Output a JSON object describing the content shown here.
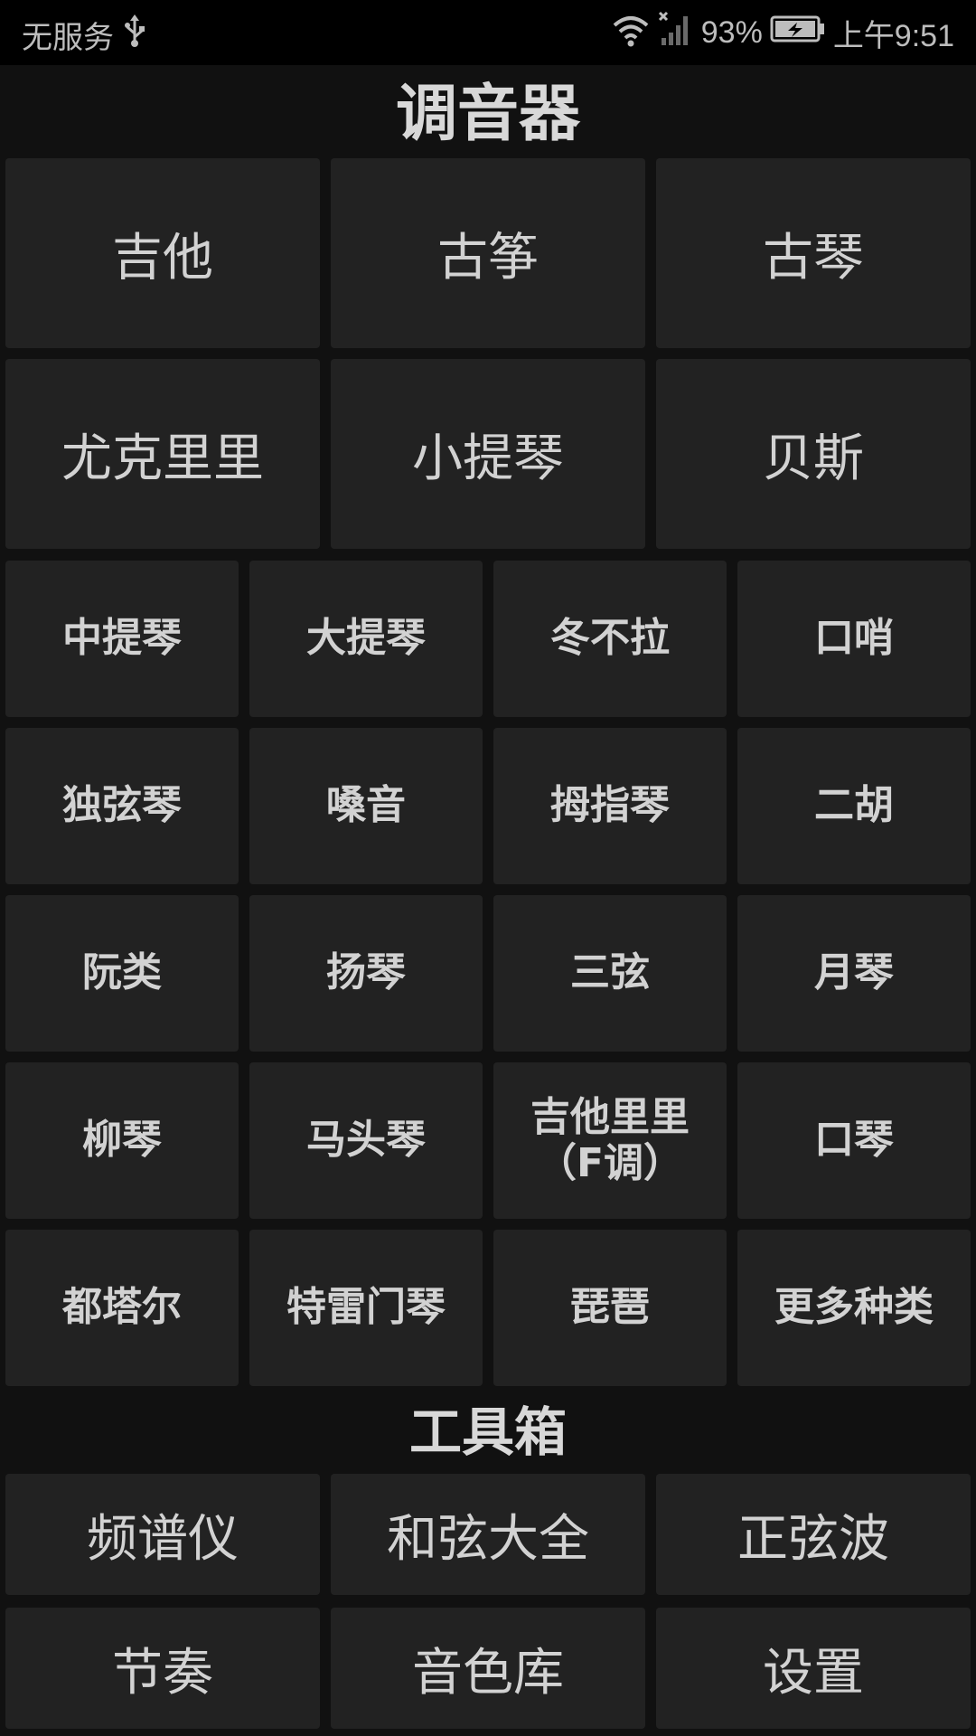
{
  "status_bar": {
    "carrier": "无服务",
    "battery_percent": "93%",
    "time": "上午9:51",
    "icons": [
      "usb-icon",
      "wifi-icon",
      "no-signal-icon",
      "battery-charging-icon"
    ]
  },
  "tuner": {
    "title": "调音器",
    "large_items": [
      {
        "label": "吉他"
      },
      {
        "label": "古筝"
      },
      {
        "label": "古琴"
      },
      {
        "label": "尤克里里"
      },
      {
        "label": "小提琴"
      },
      {
        "label": "贝斯"
      }
    ],
    "small_items": [
      {
        "label": "中提琴"
      },
      {
        "label": "大提琴"
      },
      {
        "label": "冬不拉"
      },
      {
        "label": "口哨"
      },
      {
        "label": "独弦琴"
      },
      {
        "label": "嗓音"
      },
      {
        "label": "拇指琴"
      },
      {
        "label": "二胡"
      },
      {
        "label": "阮类"
      },
      {
        "label": "扬琴"
      },
      {
        "label": "三弦"
      },
      {
        "label": "月琴"
      },
      {
        "label": "柳琴"
      },
      {
        "label": "马头琴"
      },
      {
        "label": "吉他里里",
        "label2": "（F调）"
      },
      {
        "label": "口琴"
      },
      {
        "label": "都塔尔"
      },
      {
        "label": "特雷门琴"
      },
      {
        "label": "琵琶"
      },
      {
        "label": "更多种类"
      }
    ]
  },
  "toolbox": {
    "title": "工具箱",
    "items": [
      {
        "label": "频谱仪"
      },
      {
        "label": "和弦大全"
      },
      {
        "label": "正弦波"
      },
      {
        "label": "节奏"
      },
      {
        "label": "音色库"
      },
      {
        "label": "设置"
      }
    ]
  }
}
